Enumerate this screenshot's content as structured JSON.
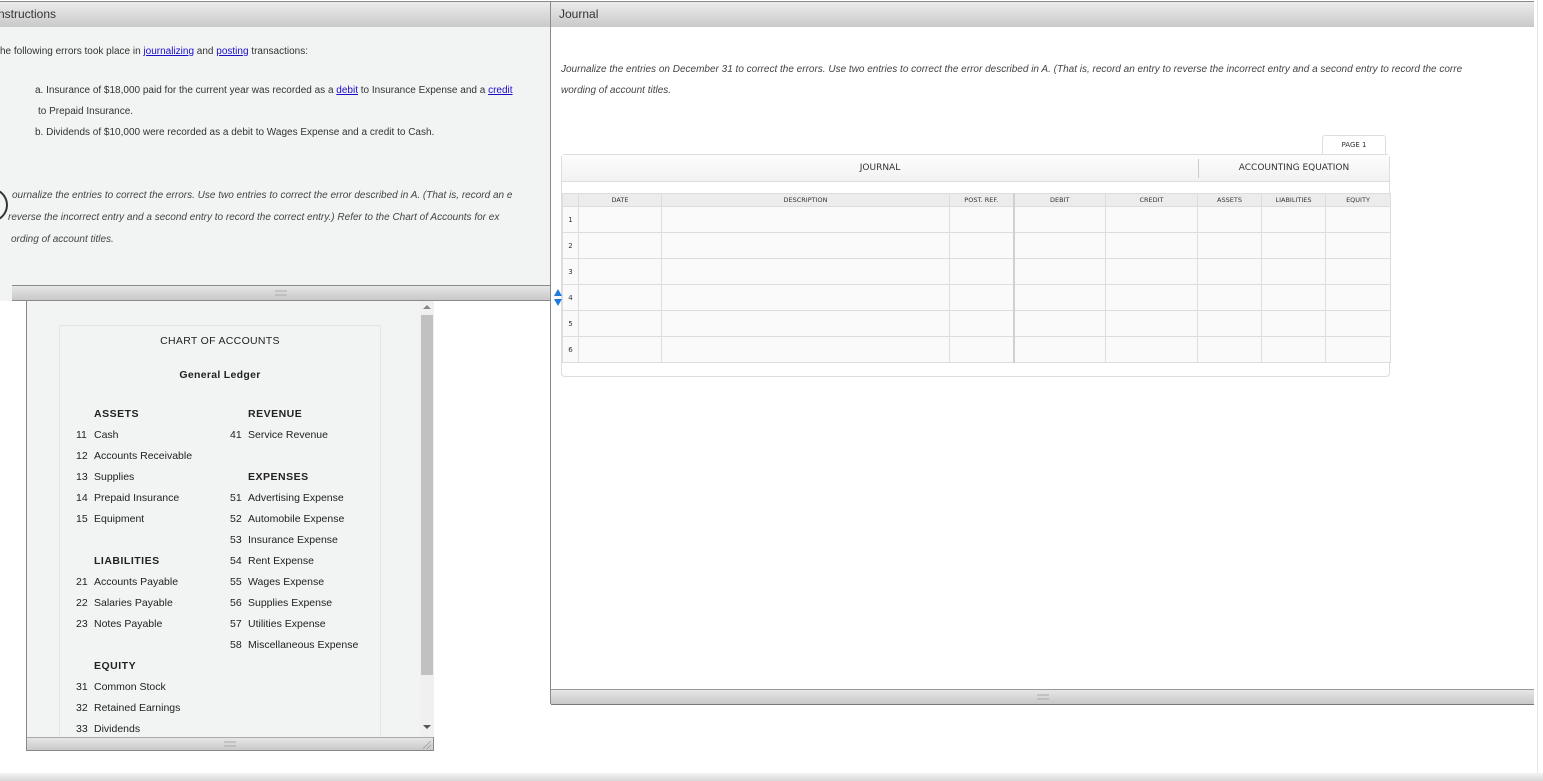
{
  "instructions": {
    "title": "nstructions",
    "intro_pre": "he following errors took place in ",
    "intro_link1": "journalizing",
    "intro_mid": " and ",
    "intro_link2": "posting",
    "intro_post": " transactions:",
    "item_a_pre": "a. Insurance of $18,000 paid for the current year was recorded as a ",
    "item_a_link1": "debit",
    "item_a_mid": " to Insurance Expense and a ",
    "item_a_link2": "credit",
    "item_a_cont": "to Prepaid Insurance.",
    "item_b": "b. Dividends of $10,000 were recorded as a debit to Wages Expense and a credit to Cash.",
    "task_line1": "ournalize the entries to correct the errors. Use two entries to correct the error described in A. (That is, record an e",
    "task_line2": "reverse the incorrect entry and a second entry to record the correct entry.) Refer to the Chart of Accounts for ex",
    "task_line3": "ording of account titles."
  },
  "chart_of_accounts": {
    "title": "CHART OF ACCOUNTS",
    "subtitle": "General Ledger",
    "left": [
      {
        "type": "head",
        "label": "ASSETS"
      },
      {
        "type": "acct",
        "num": "11",
        "label": "Cash"
      },
      {
        "type": "acct",
        "num": "12",
        "label": "Accounts Receivable"
      },
      {
        "type": "acct",
        "num": "13",
        "label": "Supplies"
      },
      {
        "type": "acct",
        "num": "14",
        "label": "Prepaid Insurance"
      },
      {
        "type": "acct",
        "num": "15",
        "label": "Equipment"
      },
      {
        "type": "blank"
      },
      {
        "type": "head",
        "label": "LIABILITIES"
      },
      {
        "type": "acct",
        "num": "21",
        "label": "Accounts Payable"
      },
      {
        "type": "acct",
        "num": "22",
        "label": "Salaries Payable"
      },
      {
        "type": "acct",
        "num": "23",
        "label": "Notes Payable"
      },
      {
        "type": "blank"
      },
      {
        "type": "head",
        "label": "EQUITY"
      },
      {
        "type": "acct",
        "num": "31",
        "label": "Common Stock"
      },
      {
        "type": "acct",
        "num": "32",
        "label": "Retained Earnings"
      },
      {
        "type": "acct",
        "num": "33",
        "label": "Dividends"
      }
    ],
    "right": [
      {
        "type": "head",
        "label": "REVENUE"
      },
      {
        "type": "acct",
        "num": "41",
        "label": "Service Revenue"
      },
      {
        "type": "blank"
      },
      {
        "type": "head",
        "label": "EXPENSES"
      },
      {
        "type": "acct",
        "num": "51",
        "label": "Advertising Expense"
      },
      {
        "type": "acct",
        "num": "52",
        "label": "Automobile Expense"
      },
      {
        "type": "acct",
        "num": "53",
        "label": "Insurance Expense"
      },
      {
        "type": "acct",
        "num": "54",
        "label": "Rent Expense"
      },
      {
        "type": "acct",
        "num": "55",
        "label": "Wages Expense"
      },
      {
        "type": "acct",
        "num": "56",
        "label": "Supplies Expense"
      },
      {
        "type": "acct",
        "num": "57",
        "label": "Utilities Expense"
      },
      {
        "type": "acct",
        "num": "58",
        "label": "Miscellaneous Expense"
      }
    ]
  },
  "journal": {
    "title": "Journal",
    "instruction_line1": "Journalize the entries on December 31 to correct the errors. Use two entries to correct the error described in A. (That is, record an entry to reverse the incorrect entry and a second entry to record the corre",
    "instruction_line2": "wording of account titles.",
    "page_tab": "PAGE 1",
    "group_journal": "JOURNAL",
    "group_equation": "ACCOUNTING EQUATION",
    "columns": [
      "DATE",
      "DESCRIPTION",
      "POST. REF.",
      "DEBIT",
      "CREDIT",
      "ASSETS",
      "LIABILITIES",
      "EQUITY"
    ],
    "rows": [
      {
        "num": "1",
        "date": "",
        "description": "",
        "post_ref": "",
        "debit": "",
        "credit": "",
        "assets": "",
        "liabilities": "",
        "equity": ""
      },
      {
        "num": "2",
        "date": "",
        "description": "",
        "post_ref": "",
        "debit": "",
        "credit": "",
        "assets": "",
        "liabilities": "",
        "equity": ""
      },
      {
        "num": "3",
        "date": "",
        "description": "",
        "post_ref": "",
        "debit": "",
        "credit": "",
        "assets": "",
        "liabilities": "",
        "equity": ""
      },
      {
        "num": "4",
        "date": "",
        "description": "",
        "post_ref": "",
        "debit": "",
        "credit": "",
        "assets": "",
        "liabilities": "",
        "equity": ""
      },
      {
        "num": "5",
        "date": "",
        "description": "",
        "post_ref": "",
        "debit": "",
        "credit": "",
        "assets": "",
        "liabilities": "",
        "equity": ""
      },
      {
        "num": "6",
        "date": "",
        "description": "",
        "post_ref": "",
        "debit": "",
        "credit": "",
        "assets": "",
        "liabilities": "",
        "equity": ""
      }
    ]
  },
  "colors": {
    "link": "#1a0dcc",
    "spinner": "#1e7bdc",
    "panel_bg": "#f2f3f3"
  }
}
